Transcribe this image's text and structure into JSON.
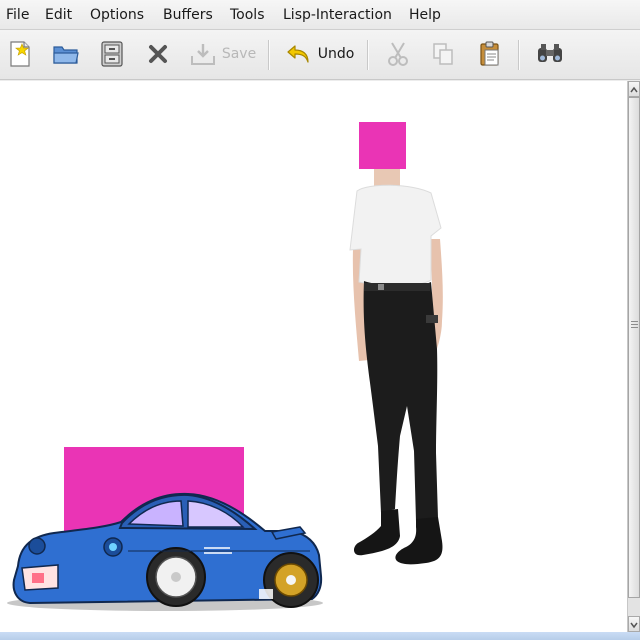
{
  "menubar": {
    "items": [
      "File",
      "Edit",
      "Options",
      "Buffers",
      "Tools",
      "Lisp-Interaction",
      "Help"
    ]
  },
  "toolbar": {
    "save_label": "Save",
    "undo_label": "Undo"
  },
  "icons": {
    "new": "new-file-icon",
    "open": "open-folder-icon",
    "dired": "file-cabinet-icon",
    "close": "close-icon",
    "save": "save-icon",
    "undo": "undo-icon",
    "cut": "scissors-icon",
    "copy": "copy-icon",
    "paste": "paste-icon",
    "search": "binoculars-icon"
  },
  "colors": {
    "redaction_magenta": "#ea34b5",
    "car_blue": "#2f6fd1",
    "shirt_white": "#f2f2f2",
    "pants_black": "#1c1c1c"
  }
}
